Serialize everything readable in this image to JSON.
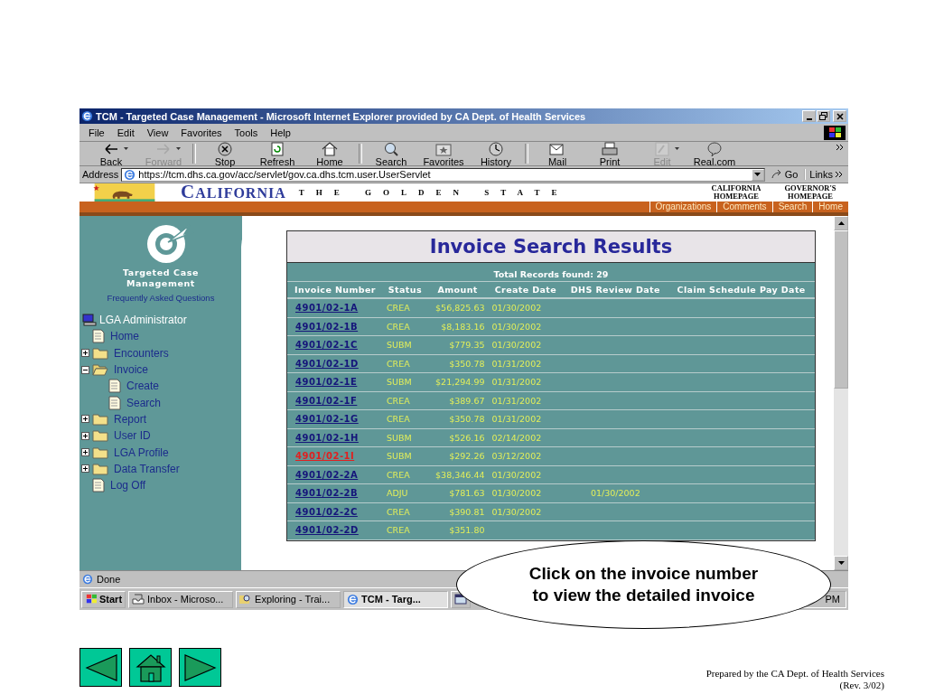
{
  "window": {
    "title": "TCM - Targeted Case Management - Microsoft Internet Explorer provided by CA Dept. of Health Services"
  },
  "menu": [
    "File",
    "Edit",
    "View",
    "Favorites",
    "Tools",
    "Help"
  ],
  "toolbar": [
    {
      "label": "Back",
      "kind": "back",
      "disabled": false,
      "dropdown": true
    },
    {
      "label": "Forward",
      "kind": "forward",
      "disabled": true,
      "dropdown": true
    },
    {
      "label": "Stop",
      "kind": "stop",
      "disabled": false,
      "dropdown": false
    },
    {
      "label": "Refresh",
      "kind": "refresh",
      "disabled": false,
      "dropdown": false
    },
    {
      "label": "Home",
      "kind": "home",
      "disabled": false,
      "dropdown": false
    },
    {
      "label": "Search",
      "kind": "search",
      "disabled": false,
      "dropdown": false
    },
    {
      "label": "Favorites",
      "kind": "favorites",
      "disabled": false,
      "dropdown": false
    },
    {
      "label": "History",
      "kind": "history",
      "disabled": false,
      "dropdown": false
    },
    {
      "label": "Mail",
      "kind": "mail",
      "disabled": false,
      "dropdown": false
    },
    {
      "label": "Print",
      "kind": "print",
      "disabled": false,
      "dropdown": false
    },
    {
      "label": "Edit",
      "kind": "edit",
      "disabled": true,
      "dropdown": true
    },
    {
      "label": "Real.com",
      "kind": "real",
      "disabled": false,
      "dropdown": false
    }
  ],
  "address": {
    "label": "Address",
    "value": "https://tcm.dhs.ca.gov/acc/servlet/gov.ca.dhs.tcm.user.UserServlet",
    "go": "Go",
    "links": "Links"
  },
  "banner": {
    "title": "CALIFORNIA",
    "tagline": "THE GOLDEN STATE",
    "links": [
      "CALIFORNIA HOMEPAGE",
      "GOVERNOR'S HOMEPAGE"
    ]
  },
  "nav": [
    "Organizations",
    "Comments",
    "Search",
    "Home"
  ],
  "sidebar": {
    "app_name": "Targeted Case Management",
    "faq": "Frequently Asked Questions",
    "tree": {
      "label": "LGA Administrator",
      "children": [
        {
          "label": "Home",
          "kind": "page"
        },
        {
          "label": "Encounters",
          "kind": "folder",
          "expanded": false
        },
        {
          "label": "Invoice",
          "kind": "folder",
          "expanded": true,
          "children": [
            {
              "label": "Create",
              "kind": "page"
            },
            {
              "label": "Search",
              "kind": "page"
            }
          ]
        },
        {
          "label": "Report",
          "kind": "folder",
          "expanded": false
        },
        {
          "label": "User ID",
          "kind": "folder",
          "expanded": false
        },
        {
          "label": "LGA Profile",
          "kind": "folder",
          "expanded": false
        },
        {
          "label": "Data Transfer",
          "kind": "folder",
          "expanded": false
        },
        {
          "label": "Log Off",
          "kind": "page"
        }
      ]
    }
  },
  "results": {
    "title": "Invoice Search Results",
    "total": "Total Records found: 29",
    "columns": [
      "Invoice Number",
      "Status",
      "Amount",
      "Create Date",
      "DHS Review Date",
      "Claim Schedule Pay Date"
    ],
    "rows": [
      {
        "invoice": "4901/02-1A",
        "active": false,
        "status": "CREA",
        "amount": "$56,825.63",
        "create_date": "01/30/2002"
      },
      {
        "invoice": "4901/02-1B",
        "active": false,
        "status": "CREA",
        "amount": "$8,183.16",
        "create_date": "01/30/2002"
      },
      {
        "invoice": "4901/02-1C",
        "active": false,
        "status": "SUBM",
        "amount": "$779.35",
        "create_date": "01/30/2002"
      },
      {
        "invoice": "4901/02-1D",
        "active": false,
        "status": "CREA",
        "amount": "$350.78",
        "create_date": "01/31/2002"
      },
      {
        "invoice": "4901/02-1E",
        "active": false,
        "status": "SUBM",
        "amount": "$21,294.99",
        "create_date": "01/31/2002"
      },
      {
        "invoice": "4901/02-1F",
        "active": false,
        "status": "CREA",
        "amount": "$389.67",
        "create_date": "01/31/2002"
      },
      {
        "invoice": "4901/02-1G",
        "active": false,
        "status": "CREA",
        "amount": "$350.78",
        "create_date": "01/31/2002"
      },
      {
        "invoice": "4901/02-1H",
        "active": false,
        "status": "SUBM",
        "amount": "$526.16",
        "create_date": "02/14/2002"
      },
      {
        "invoice": "4901/02-1I",
        "active": true,
        "status": "SUBM",
        "amount": "$292.26",
        "create_date": "03/12/2002"
      },
      {
        "invoice": "4901/02-2A",
        "active": false,
        "status": "CREA",
        "amount": "$38,346.44",
        "create_date": "01/30/2002"
      },
      {
        "invoice": "4901/02-2B",
        "active": false,
        "status": "ADJU",
        "amount": "$781.63",
        "create_date": "01/30/2002",
        "review_date": "01/30/2002"
      },
      {
        "invoice": "4901/02-2C",
        "active": false,
        "status": "CREA",
        "amount": "$390.81",
        "create_date": "01/30/2002"
      },
      {
        "invoice": "4901/02-2D",
        "active": false,
        "status": "CREA",
        "amount": "$351.80"
      }
    ]
  },
  "status_bar": "Done",
  "taskbar": {
    "start": "Start",
    "tasks": [
      {
        "label": "Inbox - Microso...",
        "kind": "inbox",
        "selected": false
      },
      {
        "label": "Exploring - Trai...",
        "kind": "explorer",
        "selected": false
      },
      {
        "label": "TCM - Targ...",
        "kind": "ie",
        "selected": true
      },
      {
        "kind": "window",
        "selected": false
      }
    ],
    "clock": "PM"
  },
  "callout": "Click on the invoice number to view the detailed invoice",
  "slide_nav": [
    {
      "kind": "previous"
    },
    {
      "kind": "home"
    },
    {
      "kind": "next"
    }
  ],
  "footer": [
    "Prepared by the CA Dept. of Health Services",
    "(Rev. 3/02)"
  ]
}
